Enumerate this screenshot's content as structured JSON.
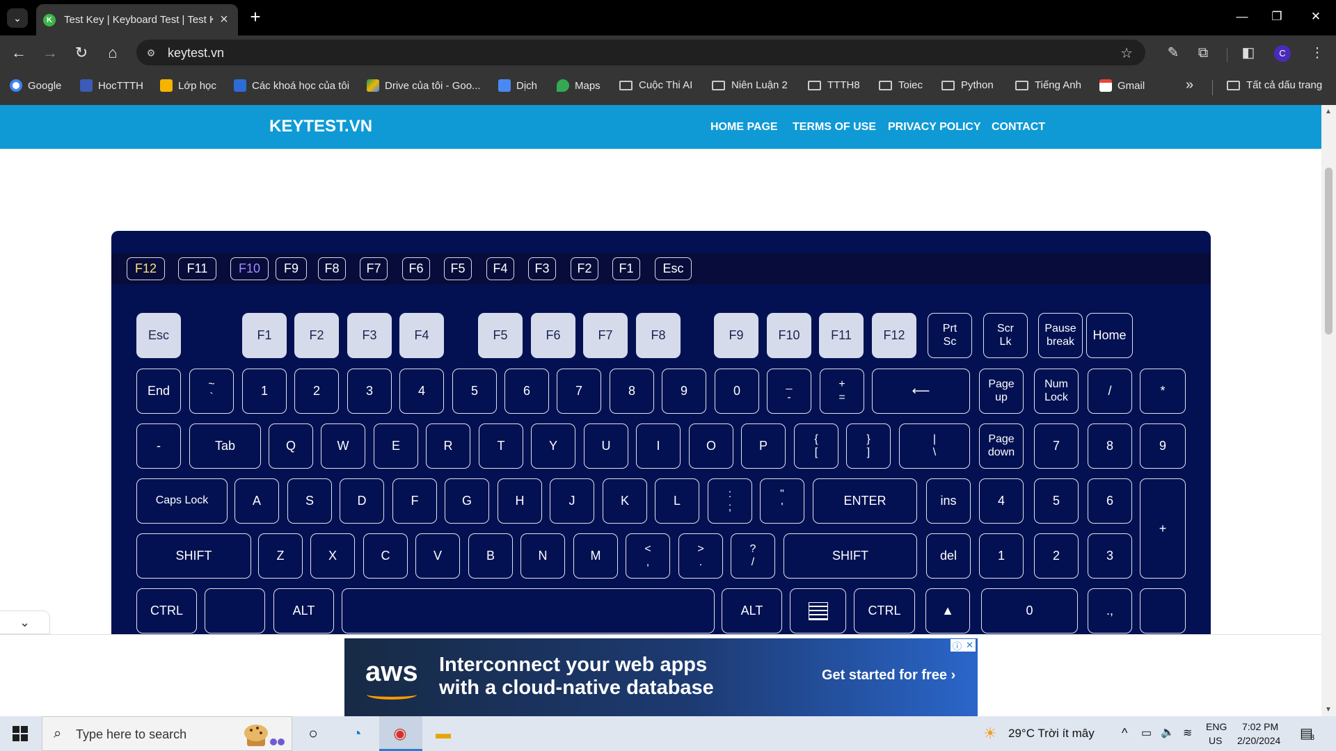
{
  "browser": {
    "tab_title": "Test Key | Keyboard Test | Test K",
    "tab_favicon_letter": "K",
    "url": "keytest.vn",
    "profile_initial": "C",
    "bookmarks": [
      {
        "label": "Google",
        "icon": "google-icon"
      },
      {
        "label": "HocTTTH",
        "icon": "hocttth-icon"
      },
      {
        "label": "Lớp học",
        "icon": "classroom-icon"
      },
      {
        "label": "Các khoá học của tôi",
        "icon": "courses-icon"
      },
      {
        "label": "Drive của tôi - Goo...",
        "icon": "drive-icon"
      },
      {
        "label": "Dịch",
        "icon": "translate-icon"
      },
      {
        "label": "Maps",
        "icon": "maps-icon"
      },
      {
        "label": "Cuộc Thi AI",
        "icon": "folder-icon"
      },
      {
        "label": "Niên Luận 2",
        "icon": "folder-icon"
      },
      {
        "label": "TTTH8",
        "icon": "folder-icon"
      },
      {
        "label": "Toiec",
        "icon": "folder-icon"
      },
      {
        "label": "Python",
        "icon": "folder-icon"
      },
      {
        "label": "Tiếng Anh",
        "icon": "folder-icon"
      },
      {
        "label": "Gmail",
        "icon": "gmail-icon"
      }
    ],
    "all_bookmarks": "Tất cả dấu trang"
  },
  "site": {
    "logo": "KEYTEST.VN",
    "nav": [
      "HOME PAGE",
      "TERMS OF USE",
      "PRIVACY POLICY",
      "CONTACT"
    ]
  },
  "history": [
    "F12",
    "F11",
    "F10",
    "F9",
    "F8",
    "F7",
    "F6",
    "F5",
    "F4",
    "F3",
    "F2",
    "F1",
    "Esc"
  ],
  "history_highlight": {
    "F12": "#ffe27a",
    "F10": "#a78bff"
  },
  "rows": {
    "fn": [
      "Esc",
      "F1",
      "F2",
      "F3",
      "F4",
      "F5",
      "F6",
      "F7",
      "F8",
      "F9",
      "F10",
      "F11",
      "F12",
      "Prt\nSc",
      "Scr\nLk",
      "Pause\nbreak",
      "Home"
    ],
    "num": [
      "End",
      "~\n`",
      "1",
      "2",
      "3",
      "4",
      "5",
      "6",
      "7",
      "8",
      "9",
      "0",
      "_\n-",
      "+\n=",
      "⟵",
      "Page\nup",
      "Num\nLock",
      "/",
      "*"
    ],
    "top": [
      "-",
      "Tab",
      "Q",
      "W",
      "E",
      "R",
      "T",
      "Y",
      "U",
      "I",
      "O",
      "P",
      "{\n[",
      "}\n]",
      "|\n\\",
      "Page\ndown",
      "7",
      "8",
      "9"
    ],
    "home": [
      "Caps Lock",
      "A",
      "S",
      "D",
      "F",
      "G",
      "H",
      "J",
      "K",
      "L",
      ":\n;",
      "\"\n'",
      "ENTER",
      "ins",
      "4",
      "5",
      "6",
      "+"
    ],
    "bottom": [
      "SHIFT",
      "Z",
      "X",
      "C",
      "V",
      "B",
      "N",
      "M",
      "<\n,",
      ">\n.",
      "?\n/",
      "SHIFT",
      "del",
      "1",
      "2",
      "3"
    ],
    "ctrl": [
      "CTRL",
      "",
      "ALT",
      "",
      "ALT",
      "",
      "CTRL",
      "▲",
      "0",
      ".,",
      ""
    ]
  },
  "ad": {
    "brand": "aws",
    "headline": "Interconnect your web apps\nwith a cloud-native database",
    "cta": "Get started for free ›"
  },
  "taskbar": {
    "search_placeholder": "Type here to search",
    "weather": "29°C  Trời ít mây",
    "lang_top": "ENG",
    "lang_bottom": "US",
    "time": "7:02 PM",
    "date": "2/20/2024",
    "notification_count": "3"
  }
}
